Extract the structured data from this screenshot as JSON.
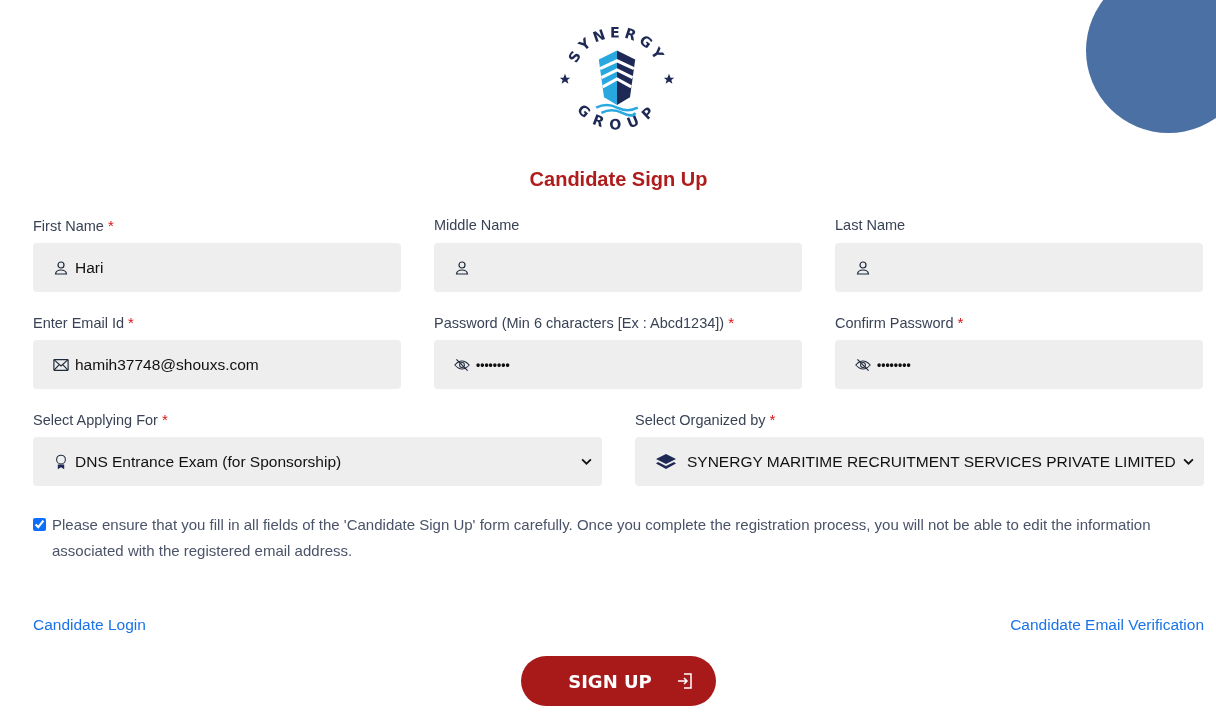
{
  "logo": {
    "top_text": "SYNERGY",
    "bottom_text": "GROUP"
  },
  "title": "Candidate Sign Up",
  "field_rows": [
    {
      "fields": [
        {
          "kind": "text",
          "label": "First Name",
          "required": true,
          "value": "Hari"
        },
        {
          "kind": "text",
          "label": "Middle Name",
          "required": false
        },
        {
          "kind": "text",
          "label": "Last Name",
          "required": false
        }
      ]
    },
    {
      "fields": [
        {
          "kind": "email",
          "label": "Enter Email Id",
          "required": true,
          "value": "hamih37748@shouxs.com"
        },
        {
          "kind": "password",
          "label": "Password (Min 6 characters [Ex : Abcd1234])",
          "required": true,
          "value": "••••••••"
        },
        {
          "kind": "password",
          "label": "Confirm Password",
          "required": true,
          "value": "••••••••"
        }
      ]
    },
    {
      "fields": [
        {
          "kind": "select-award",
          "label": "Select Applying For",
          "required": true,
          "value": "DNS Entrance Exam (for Sponsorship)"
        },
        {
          "kind": "select-layers",
          "label": "Select Organized by",
          "required": true,
          "value": "SYNERGY MARITIME RECRUITMENT SERVICES PRIVATE LIMITED"
        }
      ]
    }
  ],
  "required_mark": "*",
  "agreement": {
    "checked": true,
    "text": "Please ensure that you fill in all fields of the 'Candidate Sign Up' form carefully. Once you complete the registration process, you will not be able to edit the information associated with the registered email address."
  },
  "links": [
    "Candidate Login",
    "Candidate Email Verification"
  ],
  "submit_button": "SIGN UP"
}
